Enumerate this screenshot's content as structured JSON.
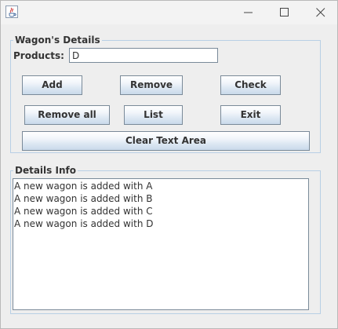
{
  "window": {
    "title": "",
    "icon": "java-icon",
    "controls": [
      "minimize-icon",
      "maximize-icon",
      "close-icon"
    ]
  },
  "wagon_details": {
    "legend": "Wagon's Details",
    "products_label": "Products:",
    "products_value": "D",
    "buttons": {
      "add": "Add",
      "remove": "Remove",
      "check": "Check",
      "remove_all": "Remove all",
      "list": "List",
      "exit": "Exit",
      "clear": "Clear Text Area"
    }
  },
  "details_info": {
    "legend": "Details Info",
    "lines": [
      "A new wagon is added with A",
      "A new wagon is added with B",
      "A new wagon is added with C",
      "A new wagon is added with D"
    ]
  },
  "colors": {
    "window_bg": "#eeeeee",
    "border_accent": "#b8cfe5",
    "button_border": "#7a8a99",
    "text": "#333333"
  }
}
